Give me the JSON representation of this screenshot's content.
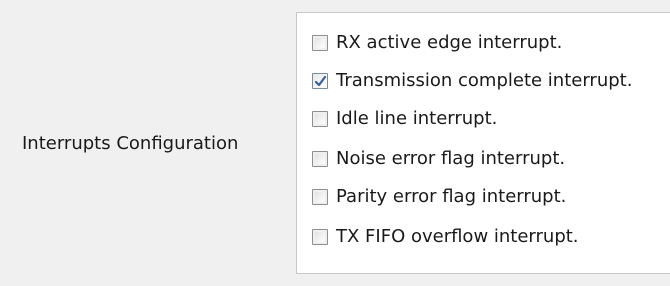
{
  "interrupts": {
    "label": "Interrupts Configuration",
    "options": [
      {
        "label": "RX active edge interrupt.",
        "checked": false
      },
      {
        "label": "Transmission complete interrupt.",
        "checked": true
      },
      {
        "label": "Idle line interrupt.",
        "checked": false
      },
      {
        "label": "Noise error flag interrupt.",
        "checked": false
      },
      {
        "label": "Parity error flag interrupt.",
        "checked": false
      },
      {
        "label": "TX FIFO overflow interrupt.",
        "checked": false
      }
    ]
  },
  "colors": {
    "background": "#f0f0f0",
    "panel": "#ffffff",
    "checkmark": "#3a5d9b"
  },
  "icons": {
    "checked": "checkmark-icon"
  }
}
